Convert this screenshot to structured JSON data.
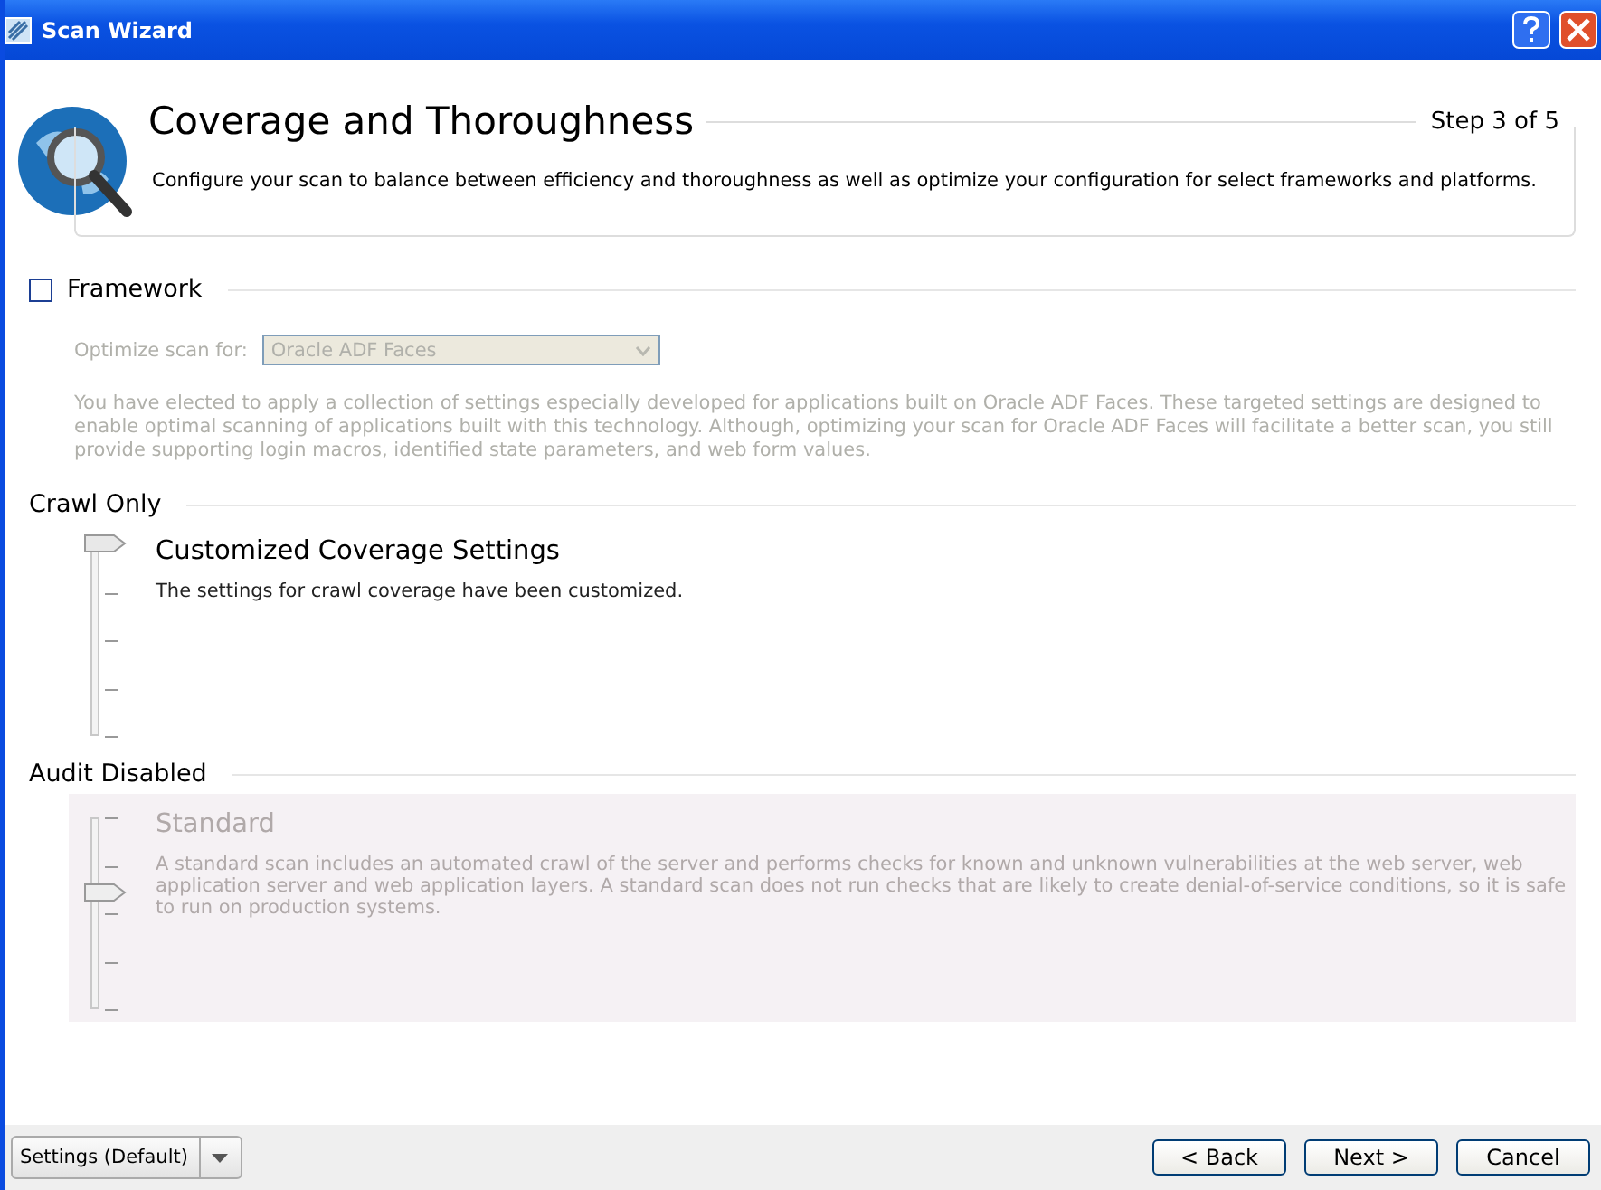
{
  "window": {
    "title": "Scan Wizard"
  },
  "header": {
    "title": "Coverage and Thoroughness",
    "step": "Step 3 of 5",
    "description": "Configure your scan to balance between efficiency and thoroughness as well as optimize your configuration for select frameworks and platforms."
  },
  "framework": {
    "label": "Framework",
    "checked": false,
    "optimize_label": "Optimize scan for:",
    "optimize_value": "Oracle ADF Faces",
    "disabled": true,
    "note": "You have elected to apply a collection of settings especially developed for applications built on Oracle ADF Faces.  These targeted settings are designed to enable optimal scanning of applications built with this technology.  Although, optimizing your scan for Oracle ADF Faces will facilitate a better scan, you still provide supporting login macros, identified state parameters, and web form values."
  },
  "sections": [
    {
      "heading": "Crawl Only",
      "title": "Customized Coverage Settings",
      "description": "The settings for crawl coverage have been customized.",
      "level": 1,
      "disabled": false
    },
    {
      "heading": "Audit Disabled",
      "title": "Standard",
      "description": "A standard scan includes an automated crawl of the server and performs checks for known and unknown vulnerabilities at the web server, web application server and web application layers.  A standard scan does not run checks that are likely to create denial-of-service conditions, so it is safe to run on production systems.",
      "level": 0.6,
      "disabled": true
    }
  ],
  "footer": {
    "settings": "Settings (Default)",
    "buttons": [
      "< Back",
      "Next >",
      "Cancel"
    ]
  }
}
